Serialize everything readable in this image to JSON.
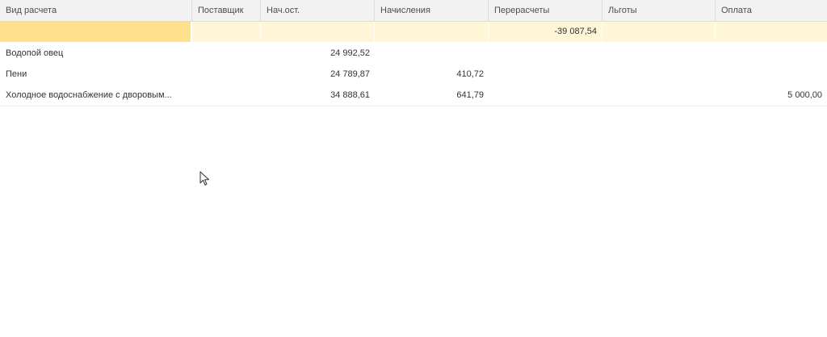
{
  "table": {
    "columns": [
      "Вид расчета",
      "Поставщик",
      "Нач.ост.",
      "Начисления",
      "Перерасчеты",
      "Льготы",
      "Оплата"
    ],
    "selected_row": [
      "",
      "",
      "",
      "",
      "-39 087,54",
      "",
      ""
    ],
    "rows": [
      [
        "Водопой овец",
        "",
        "24 992,52",
        "",
        "",
        "",
        ""
      ],
      [
        "Пени",
        "",
        "24 789,87",
        "410,72",
        "",
        "",
        ""
      ],
      [
        "Холодное водоснабжение с дворовым...",
        "",
        "34 888,61",
        "641,79",
        "",
        "",
        "5 000,00"
      ]
    ]
  },
  "colors": {
    "header_bg": "#f2f2f2",
    "selected_row_bg": "#fff6d8",
    "selected_cell_bg": "#ffe08c"
  },
  "icons": {
    "cursor": "mouse-pointer-icon"
  }
}
